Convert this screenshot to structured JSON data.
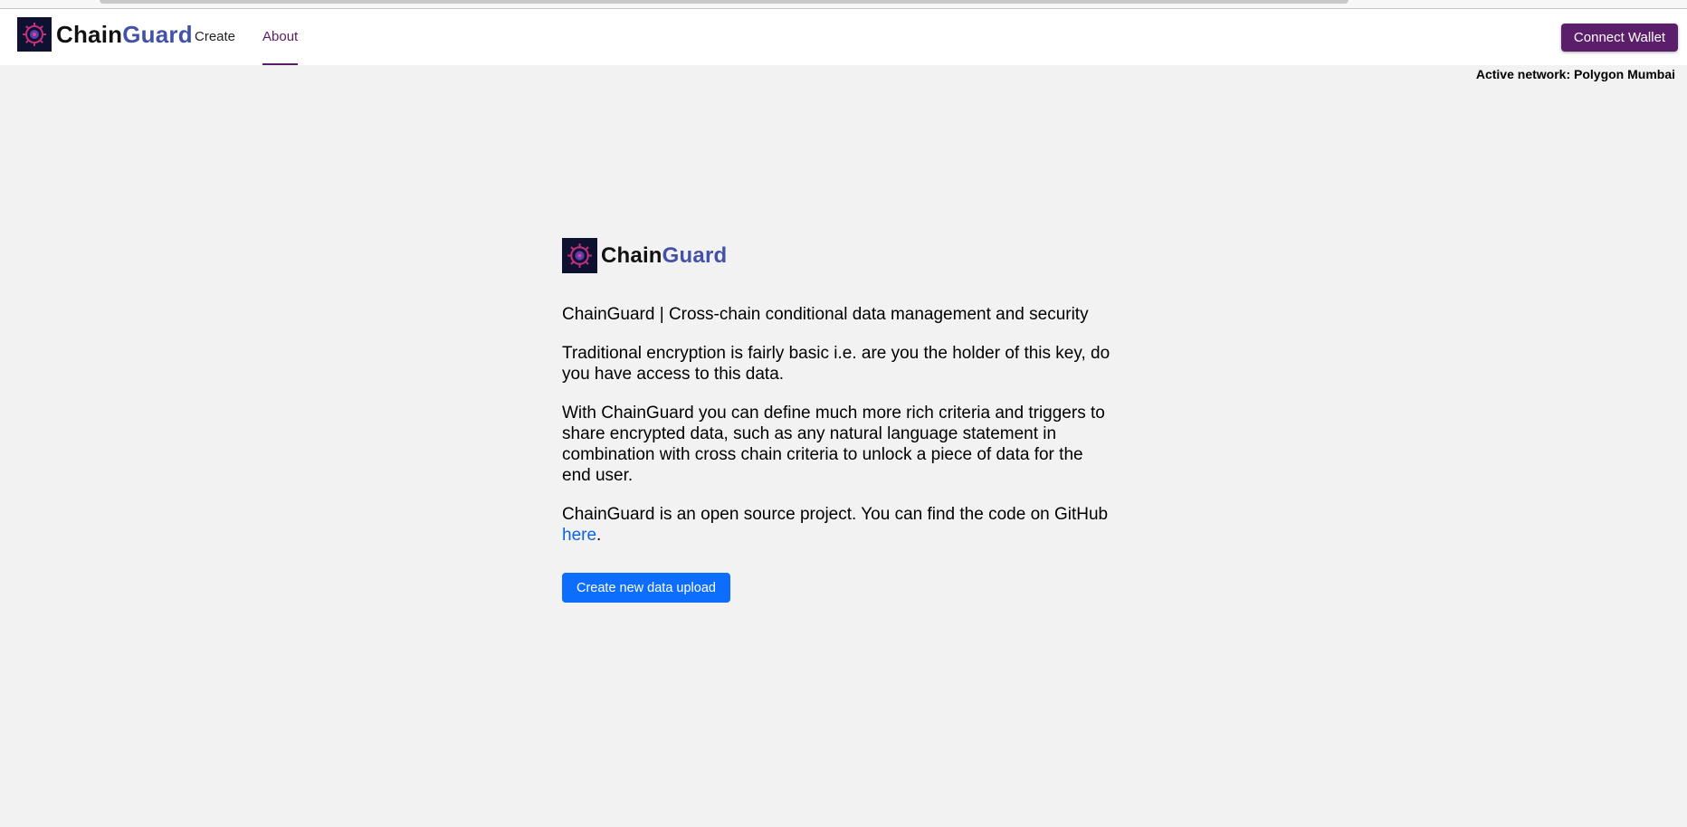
{
  "header": {
    "brand": {
      "chain": "Chain",
      "guard": "Guard"
    },
    "nav": [
      {
        "label": "Create"
      },
      {
        "label": "About"
      }
    ],
    "connect_wallet_label": "Connect Wallet"
  },
  "network": {
    "label": "Active network: Polygon Mumbai"
  },
  "about": {
    "brand": {
      "chain": "Chain",
      "guard": "Guard"
    },
    "tagline": "ChainGuard | Cross-chain conditional data management and security",
    "paragraph_1": "Traditional encryption is fairly basic i.e. are you the holder of this key, do you have access to this data.",
    "paragraph_2": "With ChainGuard you can define much more rich criteria and triggers to share encrypted data, such as any natural language statement in combination with cross chain criteria to unlock a piece of data for the end user.",
    "paragraph_3_prefix": "ChainGuard is an open source project. You can find the code on GitHub ",
    "github_link_text": "here",
    "paragraph_3_suffix": ".",
    "create_button_label": "Create new data upload"
  },
  "colors": {
    "accent_purple": "#5b1e6b",
    "brand_blue": "#4352a6",
    "primary_blue": "#0d6efd",
    "background": "#f2f2f2"
  },
  "icons": {
    "logo": "gear-shield-logo-icon"
  }
}
